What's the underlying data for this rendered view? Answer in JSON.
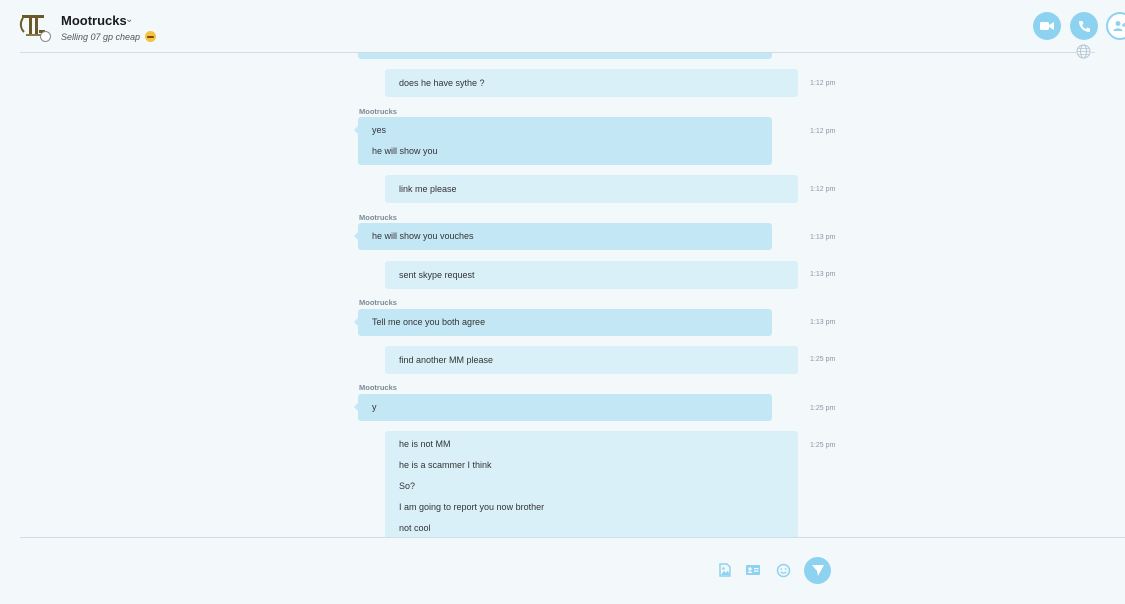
{
  "header": {
    "contact_name": "Mootrucks",
    "mood": "Selling 07 gp cheap",
    "accent": "#8ed2f1"
  },
  "icons": {
    "dropdown": "chevron-down-icon",
    "video_call": "video-camera-icon",
    "audio_call": "phone-icon",
    "add_people": "add-contact-icon",
    "globe": "globe-icon",
    "media": "media-gallery-icon",
    "contact_card": "contact-card-icon",
    "emoji": "smiley-icon",
    "send": "send-icon"
  },
  "messages": [
    {
      "dir": "out",
      "lines": [
        "does he have sythe ?"
      ],
      "time": "1:12 pm"
    },
    {
      "dir": "in",
      "sender": "Mootrucks",
      "lines": [
        "yes",
        "he will show you"
      ],
      "time": "1:12 pm"
    },
    {
      "dir": "out",
      "lines": [
        "link me please"
      ],
      "time": "1:12 pm"
    },
    {
      "dir": "in",
      "sender": "Mootrucks",
      "lines": [
        "he will show you vouches"
      ],
      "time": "1:13 pm"
    },
    {
      "dir": "out",
      "lines": [
        "sent skype request"
      ],
      "time": "1:13 pm"
    },
    {
      "dir": "in",
      "sender": "Mootrucks",
      "lines": [
        "Tell me once you both agree"
      ],
      "time": "1:13 pm"
    },
    {
      "dir": "out",
      "lines": [
        "find another MM please"
      ],
      "time": "1:25 pm"
    },
    {
      "dir": "in",
      "sender": "Mootrucks",
      "lines": [
        "y"
      ],
      "time": "1:25 pm"
    },
    {
      "dir": "out",
      "lines": [
        "he is not MM",
        "he is a scammer I think",
        "So?",
        "I am going to report you now brother",
        "not cool"
      ],
      "time": "1:25 pm"
    }
  ]
}
